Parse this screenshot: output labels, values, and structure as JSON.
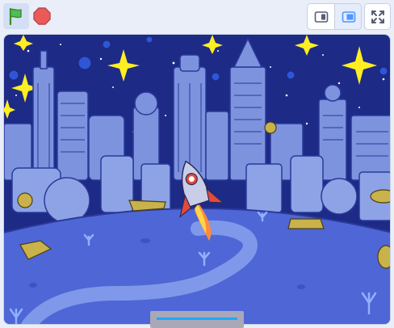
{
  "toolbar": {
    "green_flag_icon": "green-flag-icon",
    "stop_icon": "stop-sign-icon",
    "small_stage_icon": "small-stage-icon",
    "normal_stage_icon": "normal-stage-icon",
    "fullscreen_icon": "fullscreen-icon"
  },
  "stage": {
    "scene": "space-city-rocket",
    "colors": {
      "sky": "#1d2a86",
      "buildings": "#7d93de",
      "ground": "#4f66d6",
      "path": "#7f98e9",
      "stars": "#ffee22",
      "rocket_flame": "#ff6633"
    }
  },
  "monitor": {
    "progress": 1.0
  }
}
